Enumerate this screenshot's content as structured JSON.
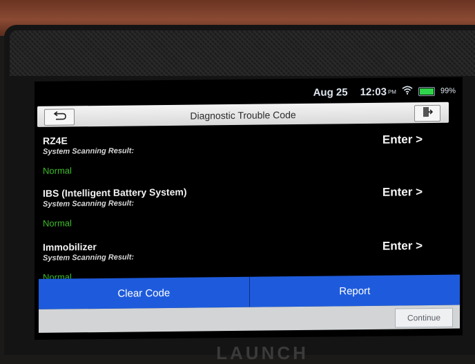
{
  "status_bar": {
    "date": "Aug 25",
    "time": "12:03",
    "ampm": "PM",
    "battery_percent": "99%",
    "battery_level": 0.99,
    "wifi_icon": "wifi-icon"
  },
  "titlebar": {
    "title": "Diagnostic Trouble Code",
    "back_icon": "back-arrow-icon",
    "exit_icon": "exit-icon"
  },
  "systems": [
    {
      "name": "RZ4E",
      "subtitle": "System Scanning Result:",
      "result": "Normal",
      "enter": "Enter >"
    },
    {
      "name": "IBS (Intelligent Battery System)",
      "subtitle": "System Scanning Result:",
      "result": "Normal",
      "enter": "Enter >"
    },
    {
      "name": "Immobilizer",
      "subtitle": "System Scanning Result:",
      "result": "Normal",
      "enter": "Enter >"
    }
  ],
  "actions": {
    "clear_code": "Clear Code",
    "report": "Report"
  },
  "footer": {
    "continue": "Continue"
  },
  "device": {
    "brand": "LAUNCH"
  },
  "colors": {
    "accent_blue": "#1e5bdc",
    "normal_green": "#3dbb2a",
    "battery_green": "#2fd54a"
  }
}
